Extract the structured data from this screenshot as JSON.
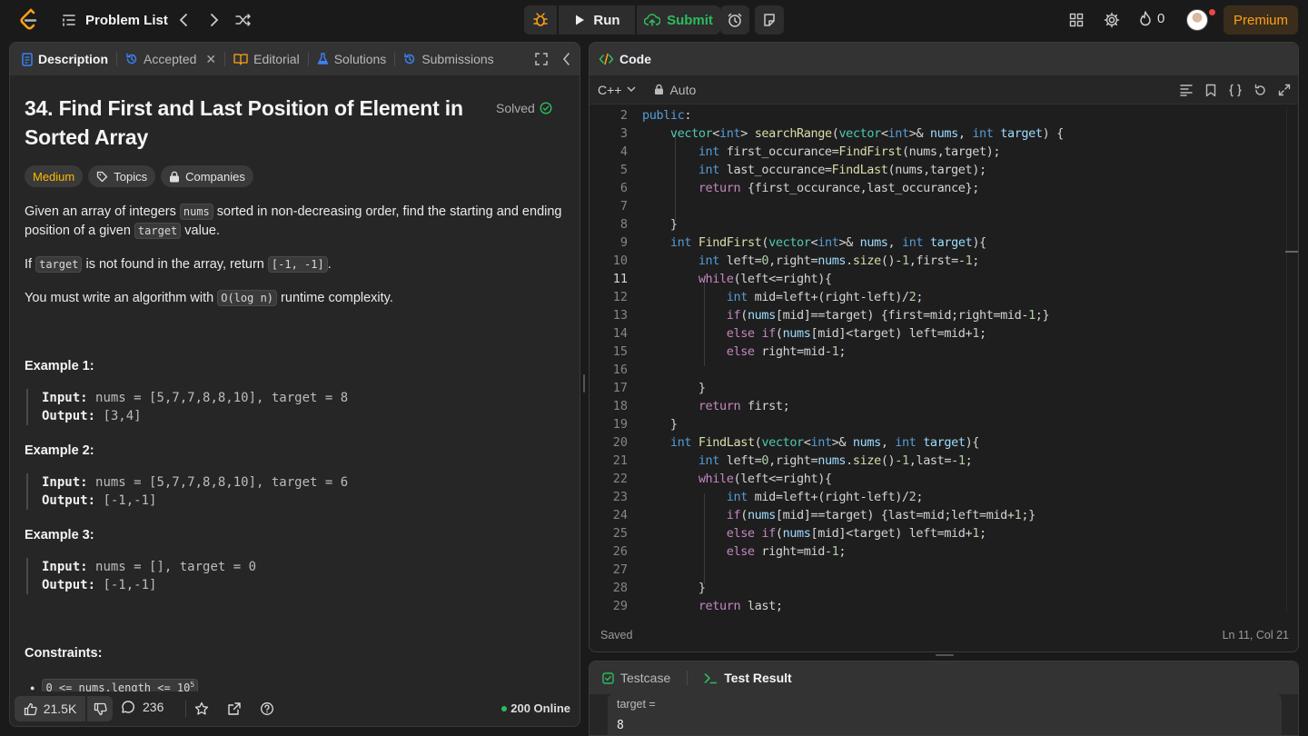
{
  "topbar": {
    "problem_list": "Problem List",
    "run": "Run",
    "submit": "Submit",
    "streak": "0",
    "premium": "Premium"
  },
  "tabs": {
    "description": "Description",
    "accepted": "Accepted",
    "editorial": "Editorial",
    "solutions": "Solutions",
    "submissions": "Submissions"
  },
  "problem": {
    "title": "34. Find First and Last Position of Element in Sorted Array",
    "status": "Solved",
    "difficulty": "Medium",
    "topics": "Topics",
    "companies": "Companies",
    "p1_a": "Given an array of integers ",
    "p1_code1": "nums",
    "p1_b": " sorted in non-decreasing order, find the starting and ending position of a given ",
    "p1_code2": "target",
    "p1_c": " value.",
    "p2_a": "If ",
    "p2_code1": "target",
    "p2_b": " is not found in the array, return ",
    "p2_code2": "[-1, -1]",
    "p2_c": ".",
    "p3_a": "You must write an algorithm with ",
    "p3_code": "O(log n)",
    "p3_b": " runtime complexity.",
    "examples": [
      {
        "title": "Example 1:",
        "input_label": "Input:",
        "input": "nums = [5,7,7,8,8,10], target = 8",
        "output_label": "Output:",
        "output": "[3,4]"
      },
      {
        "title": "Example 2:",
        "input_label": "Input:",
        "input": "nums = [5,7,7,8,8,10], target = 6",
        "output_label": "Output:",
        "output": "[-1,-1]"
      },
      {
        "title": "Example 3:",
        "input_label": "Input:",
        "input": "nums = [], target = 0",
        "output_label": "Output:",
        "output": "[-1,-1]"
      }
    ],
    "constraints_title": "Constraints:",
    "constraint_1": "0 <= nums.length <= 10",
    "constraint_1_sup": "5"
  },
  "bottom_bar": {
    "likes": "21.5K",
    "comments": "236",
    "online": "200 Online"
  },
  "code_panel": {
    "title": "Code",
    "language": "C++",
    "mode": "Auto",
    "saved": "Saved",
    "cursor": "Ln 11, Col 21",
    "current_line": 11
  },
  "test_panel": {
    "testcase": "Testcase",
    "test_result": "Test Result",
    "var_label": "target =",
    "var_value": "8"
  },
  "colors": {
    "accent_orange": "#ffa116",
    "submit_green": "#2cbb5d",
    "medium_yellow": "#ffb800"
  }
}
